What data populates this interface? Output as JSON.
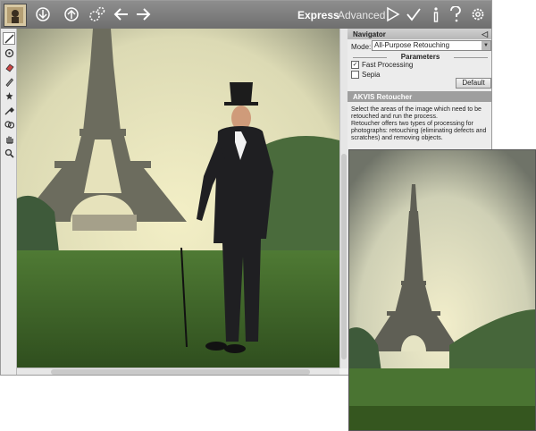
{
  "toolbar": {
    "modes": {
      "express": "Express",
      "advanced": "Advanced"
    },
    "icons": [
      "logo-icon",
      "open-icon",
      "save-icon",
      "preferences-icon",
      "back-icon",
      "forward-icon",
      "run-icon",
      "apply-icon",
      "info-icon",
      "help-icon",
      "settings-icon"
    ]
  },
  "tools": [
    "retouch-brush",
    "stamp",
    "eraser",
    "pencil",
    "magic-wand",
    "dropper",
    "patch",
    "hand",
    "zoom"
  ],
  "navigator": {
    "title": "Navigator"
  },
  "settings": {
    "mode_label": "Mode:",
    "mode_value": "All-Purpose Retouching",
    "parameters_title": "Parameters",
    "fast_processing": {
      "label": "Fast Processing",
      "checked": true
    },
    "sepia": {
      "label": "Sepia",
      "checked": false
    },
    "default_button": "Default"
  },
  "info": {
    "title": "AKVIS Retoucher",
    "text": "Select the areas of the image which need to be retouched and run the process.\nRetoucher offers two types of processing for photographs: retouching (eliminating defects and scratches) and removing objects."
  }
}
